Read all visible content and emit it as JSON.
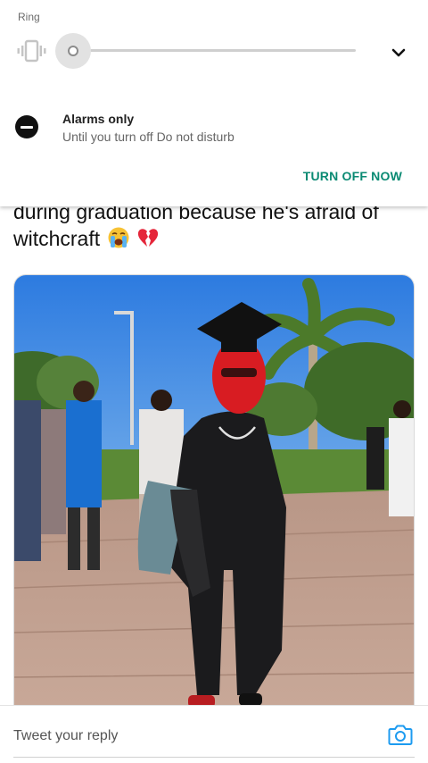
{
  "volume_panel": {
    "stream_label": "Ring",
    "ring_level": 0,
    "ringer_mode_icon": "vibrate-icon",
    "expand_icon": "chevron-down-icon"
  },
  "dnd": {
    "icon": "do-not-disturb-icon",
    "title": "Alarms only",
    "subtitle": "Until you turn off Do not disturb",
    "action_label": "TURN OFF NOW",
    "action_color": "#0a8a73"
  },
  "tweet": {
    "text_line_1": "during graduation because he's afraid of",
    "text_line_2": "witchcraft",
    "emojis": [
      "loudly-crying-face-emoji",
      "broken-heart-emoji"
    ]
  },
  "reply": {
    "placeholder": "Tweet your reply",
    "camera_icon": "camera-icon",
    "accent_color": "#1d9bf0"
  }
}
